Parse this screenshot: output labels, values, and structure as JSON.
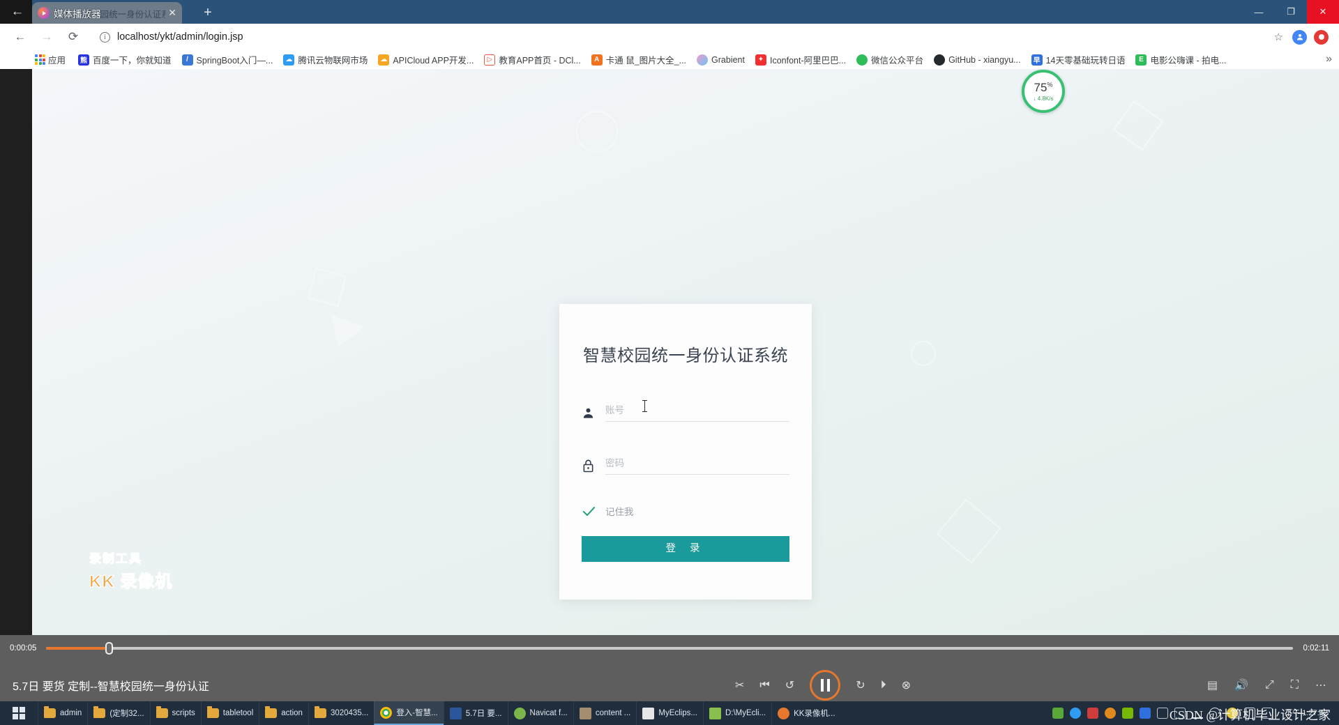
{
  "browser": {
    "tab": {
      "title_overlay": "媒体播放器",
      "page_title": "登入-智慧校园统一身份认证系统",
      "close_glyph": "✕",
      "new_tab_glyph": "+"
    },
    "window_controls": {
      "minimize": "—",
      "maximize": "❐",
      "close": "✕"
    },
    "nav": {
      "back_glyph": "←",
      "forward_glyph": "→",
      "reload_glyph": "⟳",
      "url": "localhost/ykt/admin/login.jsp",
      "star_glyph": "☆",
      "profile_initial": "●"
    },
    "bookmarks": {
      "apps_label": "应用",
      "overflow_glyph": "»",
      "items": [
        {
          "label": "百度一下，你就知道",
          "icon": "baidu-icon",
          "color": "#2932e1",
          "glyph": "熊"
        },
        {
          "label": "SpringBoot入门—...",
          "icon": "springboot-icon",
          "color": "#3b77d8",
          "glyph": "/"
        },
        {
          "label": "腾讯云物联网市场",
          "icon": "tencent-cloud-icon",
          "color": "#2f9cf4",
          "glyph": "☁"
        },
        {
          "label": "APICloud APP开发...",
          "icon": "apicloud-icon",
          "color": "#f5a623",
          "glyph": "☁"
        },
        {
          "label": "教育APP首页 - DCl...",
          "icon": "dcloud-icon",
          "color": "#ffffff",
          "glyph": "▷"
        },
        {
          "label": "卡通 鼠_图片大全_...",
          "icon": "image-search-icon",
          "color": "#f2711c",
          "glyph": "A"
        },
        {
          "label": "Grabient",
          "icon": "grabient-icon",
          "color": "#c06cf0",
          "glyph": "◓"
        },
        {
          "label": "Iconfont-阿里巴巴...",
          "icon": "iconfont-icon",
          "color": "#f23030",
          "glyph": "✦"
        },
        {
          "label": "微信公众平台",
          "icon": "wechat-icon",
          "color": "#2ebd59",
          "glyph": "✉"
        },
        {
          "label": "GitHub - xiangyu...",
          "icon": "github-icon",
          "color": "#24292e",
          "glyph": "●"
        },
        {
          "label": "14天零基础玩转日语",
          "icon": "japanese-course-icon",
          "color": "#2f6fe0",
          "glyph": "早"
        },
        {
          "label": "电影公嗨课 - 拍电...",
          "icon": "movie-course-icon",
          "color": "#2ebd59",
          "glyph": "E"
        }
      ]
    }
  },
  "login_page": {
    "title": "智慧校园统一身份认证系统",
    "username": {
      "placeholder": "账号",
      "value": "",
      "icon": "person-icon"
    },
    "password": {
      "placeholder": "密码",
      "value": "",
      "icon": "lock-icon"
    },
    "remember": {
      "label": "记住我",
      "checked": true,
      "icon": "check-icon"
    },
    "submit_label": "登 录"
  },
  "speed_widget": {
    "percent": "75",
    "percent_unit": "%",
    "rate": "↓ 4.8K/s",
    "ring_color": "#38c172"
  },
  "recorder_watermark": {
    "line1": "录制工具",
    "line2": "KK 录像机"
  },
  "media_player": {
    "current_time": "0:00:05",
    "total_time": "0:02:11",
    "progress_percent": 5,
    "title": "5.7日 要货 定制--智慧校园统一身份认证",
    "controls": {
      "shuffle_glyph": "✂",
      "prev_glyph": "⏮",
      "rewind_glyph": "↺",
      "play_pause": "pause",
      "forward_glyph": "↻",
      "next_glyph": "⏵",
      "stop_glyph": "⊗",
      "screenshot_glyph": "▤",
      "volume_glyph": "🔊",
      "expand_glyph": "⤢",
      "fullscreen_glyph": "⛶",
      "more_glyph": "⋯"
    }
  },
  "taskbar": {
    "start_label": "start",
    "items": [
      {
        "label": "admin",
        "icon": "folder-icon",
        "active": false
      },
      {
        "label": "(定制32...",
        "icon": "folder-icon",
        "active": false
      },
      {
        "label": "scripts",
        "icon": "folder-icon",
        "active": false
      },
      {
        "label": "tabletool",
        "icon": "folder-icon",
        "active": false
      },
      {
        "label": "action",
        "icon": "folder-icon",
        "active": false
      },
      {
        "label": "3020435...",
        "icon": "folder-icon",
        "active": false
      },
      {
        "label": "登入-智慧...",
        "icon": "chrome-icon",
        "active": true,
        "color": "#4285f4"
      },
      {
        "label": "5.7日 要...",
        "icon": "word-icon",
        "active": false,
        "color": "#2b579a"
      },
      {
        "label": "Navicat f...",
        "icon": "navicat-icon",
        "active": false,
        "color": "#7ab648"
      },
      {
        "label": "content ...",
        "icon": "editor-icon",
        "active": false,
        "color": "#a58d6f"
      },
      {
        "label": "MyEclips...",
        "icon": "myeclipse-icon",
        "active": false,
        "color": "#dddddd"
      },
      {
        "label": "D:\\MyEcli...",
        "icon": "explorer-icon",
        "active": false,
        "color": "#8bbf4d"
      },
      {
        "label": "KK录像机...",
        "icon": "kk-recorder-icon",
        "active": false,
        "color": "#e8772e"
      }
    ],
    "tray": [
      {
        "name": "app-tray-icon",
        "color": "#5aa83a"
      },
      {
        "name": "browser-tray-icon",
        "color": "#2f9cf4"
      },
      {
        "name": "security-tray-icon",
        "color": "#d03b3b"
      },
      {
        "name": "update-tray-icon",
        "color": "#e08a1e"
      },
      {
        "name": "nvidia-tray-icon",
        "color": "#76b900"
      },
      {
        "name": "bluetooth-tray-icon",
        "color": "#2f6fe0"
      },
      {
        "name": "usb-tray-icon",
        "color": "#b9c3cd"
      },
      {
        "name": "device-tray-icon",
        "color": "#b9c3cd"
      },
      {
        "name": "network-tray-icon",
        "color": "#dfe6ee"
      },
      {
        "name": "volume-tray-icon",
        "color": "#dfe6ee"
      },
      {
        "name": "ime-tray-icon",
        "color": "#e6c84d"
      },
      {
        "name": "ime-mode-icon",
        "color": "#dfe6ee"
      },
      {
        "name": "keyboard-tray-icon",
        "color": "#b9c3cd"
      }
    ],
    "clock": {
      "period_time": "下午 1:27:42"
    }
  },
  "watermark": {
    "text": "CSDN @计算机毕业设计之家"
  }
}
